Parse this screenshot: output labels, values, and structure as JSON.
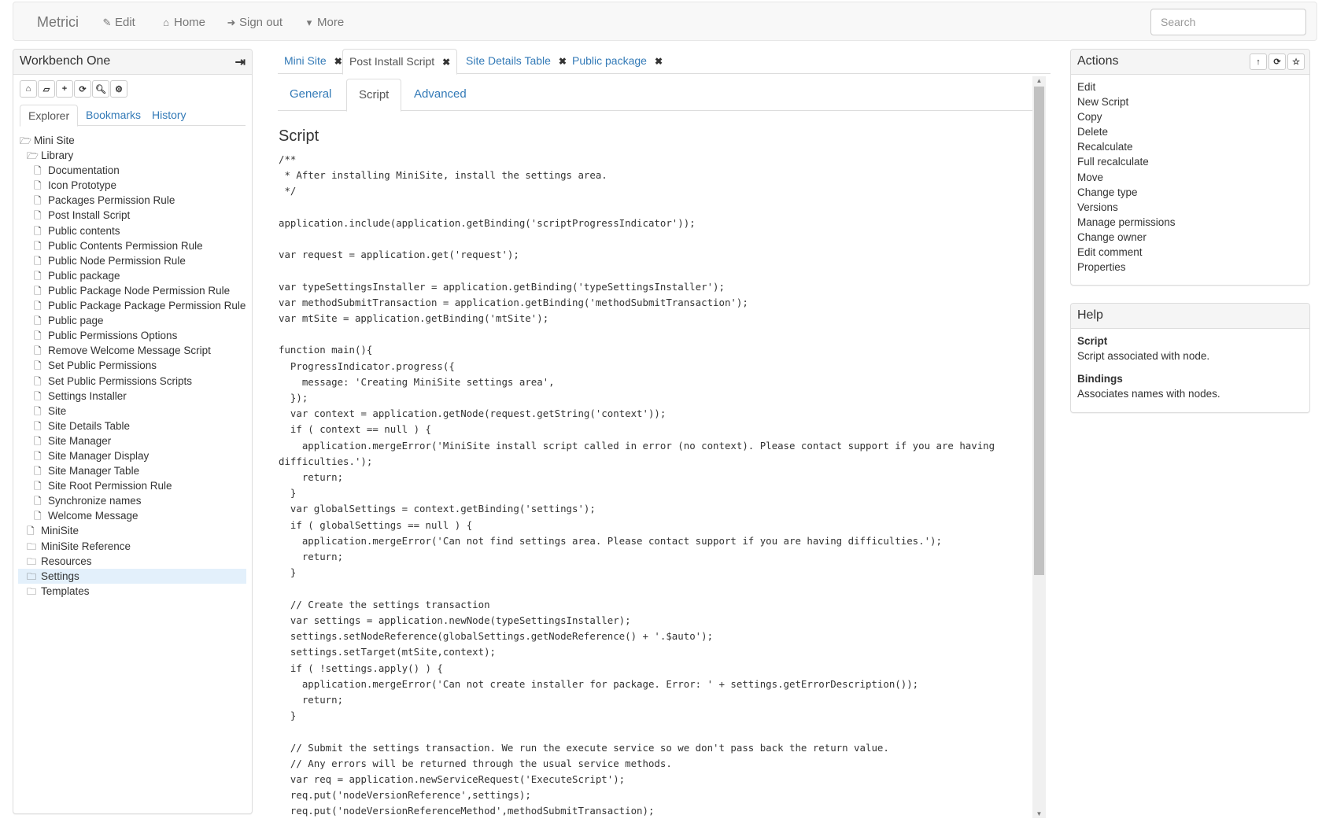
{
  "navbar": {
    "brand": "Metrici",
    "links": [
      {
        "label": "Edit",
        "icon": "edit-icon",
        "glyph": "✎"
      },
      {
        "label": "Home",
        "icon": "home-icon",
        "glyph": "⌂"
      },
      {
        "label": "Sign out",
        "icon": "sign-out-icon",
        "glyph": "➜"
      },
      {
        "label": "More",
        "icon": "caret-down-icon",
        "glyph": "▾"
      }
    ],
    "search_placeholder": "Search",
    "search_value": ""
  },
  "workbench": {
    "title": "Workbench One",
    "exit_icon": "sign-out-icon",
    "toolbar": [
      {
        "name": "home",
        "icon": "home-icon",
        "glyph": "⌂"
      },
      {
        "name": "open",
        "icon": "folder-open-icon",
        "glyph": "🗁"
      },
      {
        "name": "add",
        "icon": "plus-icon",
        "glyph": "+"
      },
      {
        "name": "refresh",
        "icon": "refresh-icon",
        "glyph": "⟳"
      },
      {
        "name": "search",
        "icon": "search-icon",
        "glyph": "⚲"
      },
      {
        "name": "settings",
        "icon": "gear-icon",
        "glyph": "⚙"
      }
    ],
    "tabs": [
      "Explorer",
      "Bookmarks",
      "History"
    ],
    "active_tab": "Explorer",
    "tree": [
      {
        "label": "Mini Site",
        "type": "folder-open",
        "depth": 0
      },
      {
        "label": "Library",
        "type": "folder-open",
        "depth": 1
      },
      {
        "label": "Documentation",
        "type": "file",
        "depth": 2
      },
      {
        "label": "Icon Prototype",
        "type": "file",
        "depth": 2
      },
      {
        "label": "Packages Permission Rule",
        "type": "file",
        "depth": 2
      },
      {
        "label": "Post Install Script",
        "type": "file",
        "depth": 2
      },
      {
        "label": "Public contents",
        "type": "file",
        "depth": 2
      },
      {
        "label": "Public Contents Permission Rule",
        "type": "file",
        "depth": 2
      },
      {
        "label": "Public Node Permission Rule",
        "type": "file",
        "depth": 2
      },
      {
        "label": "Public package",
        "type": "file",
        "depth": 2
      },
      {
        "label": "Public Package Node Permission Rule",
        "type": "file",
        "depth": 2
      },
      {
        "label": "Public Package Package Permission Rule",
        "type": "file",
        "depth": 2
      },
      {
        "label": "Public page",
        "type": "file",
        "depth": 2
      },
      {
        "label": "Public Permissions Options",
        "type": "file",
        "depth": 2
      },
      {
        "label": "Remove Welcome Message Script",
        "type": "file",
        "depth": 2
      },
      {
        "label": "Set Public Permissions",
        "type": "file",
        "depth": 2
      },
      {
        "label": "Set Public Permissions Scripts",
        "type": "file",
        "depth": 2
      },
      {
        "label": "Settings Installer",
        "type": "file",
        "depth": 2
      },
      {
        "label": "Site",
        "type": "file",
        "depth": 2
      },
      {
        "label": "Site Details Table",
        "type": "file",
        "depth": 2
      },
      {
        "label": "Site Manager",
        "type": "file",
        "depth": 2
      },
      {
        "label": "Site Manager Display",
        "type": "file",
        "depth": 2
      },
      {
        "label": "Site Manager Table",
        "type": "file",
        "depth": 2
      },
      {
        "label": "Site Root Permission Rule",
        "type": "file",
        "depth": 2
      },
      {
        "label": "Synchronize names",
        "type": "file",
        "depth": 2
      },
      {
        "label": "Welcome Message",
        "type": "file",
        "depth": 2
      },
      {
        "label": "MiniSite",
        "type": "file",
        "depth": 1
      },
      {
        "label": "MiniSite Reference",
        "type": "folder",
        "depth": 1
      },
      {
        "label": "Resources",
        "type": "folder",
        "depth": 1
      },
      {
        "label": "Settings",
        "type": "folder",
        "depth": 1,
        "selected": true
      },
      {
        "label": "Templates",
        "type": "folder",
        "depth": 1
      }
    ]
  },
  "document_tabs": [
    {
      "label": "Mini Site",
      "active": false
    },
    {
      "label": "Post Install Script",
      "active": true
    },
    {
      "label": "Site Details Table",
      "active": false
    },
    {
      "label": "Public package",
      "active": false
    }
  ],
  "sub_tabs": [
    "General",
    "Script",
    "Advanced"
  ],
  "active_sub_tab": "Script",
  "script": {
    "title": "Script",
    "code": "/**\n * After installing MiniSite, install the settings area.\n */\n\napplication.include(application.getBinding('scriptProgressIndicator'));\n\nvar request = application.get('request');\n\nvar typeSettingsInstaller = application.getBinding('typeSettingsInstaller');\nvar methodSubmitTransaction = application.getBinding('methodSubmitTransaction');\nvar mtSite = application.getBinding('mtSite');\n\nfunction main(){\n  ProgressIndicator.progress({\n    message: 'Creating MiniSite settings area',\n  });\n  var context = application.getNode(request.getString('context'));\n  if ( context == null ) {\n    application.mergeError('MiniSite install script called in error (no context). Please contact support if you are having difficulties.');\n    return;\n  }\n  var globalSettings = context.getBinding('settings');\n  if ( globalSettings == null ) {\n    application.mergeError('Can not find settings area. Please contact support if you are having difficulties.');\n    return;\n  }\n\n  // Create the settings transaction\n  var settings = application.newNode(typeSettingsInstaller);\n  settings.setNodeReference(globalSettings.getNodeReference() + '.$auto');\n  settings.setTarget(mtSite,context);\n  if ( !settings.apply() ) {\n    application.mergeError('Can not create installer for package. Error: ' + settings.getErrorDescription());\n    return;\n  }\n\n  // Submit the settings transaction. We run the execute service so we don't pass back the return value.\n  // Any errors will be returned through the usual service methods.\n  var req = application.newServiceRequest('ExecuteScript');\n  req.put('nodeVersionReference',settings);\n  req.put('nodeVersionReferenceMethod',methodSubmitTransaction);"
  },
  "actions": {
    "title": "Actions",
    "header_buttons": [
      {
        "name": "up",
        "icon": "arrow-up-icon",
        "glyph": "↑"
      },
      {
        "name": "refresh",
        "icon": "refresh-icon",
        "glyph": "⟳"
      },
      {
        "name": "bookmark",
        "icon": "star-icon",
        "glyph": "☆"
      }
    ],
    "items": [
      "Edit",
      "New Script",
      "Copy",
      "Delete",
      "Recalculate",
      "Full recalculate",
      "Move",
      "Change type",
      "Versions",
      "Manage permissions",
      "Change owner",
      "Edit comment",
      "Properties"
    ]
  },
  "help": {
    "title": "Help",
    "entries": [
      {
        "term": "Script",
        "description": "Script associated with node."
      },
      {
        "term": "Bindings",
        "description": "Associates names with nodes."
      }
    ]
  },
  "colors": {
    "link": "#337ab7",
    "selected_row": "#e3f0fb",
    "panel_heading": "#f5f5f5",
    "navbar": "#f8f8f8"
  }
}
